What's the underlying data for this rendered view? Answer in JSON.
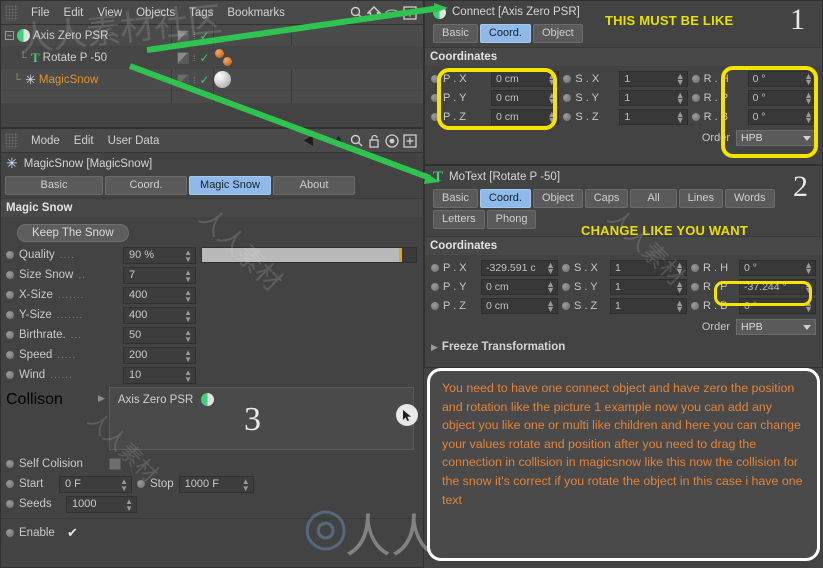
{
  "app": {
    "object_manager_menu": [
      "File",
      "Edit",
      "View",
      "Objects",
      "Tags",
      "Bookmarks"
    ],
    "attr_manager_menu": [
      "Mode",
      "Edit",
      "User Data"
    ]
  },
  "object_tree": {
    "rows": [
      {
        "name": "Axis Zero PSR",
        "icon": "connect-icon",
        "indent": 0,
        "color": "normal"
      },
      {
        "name": "Rotate P -50",
        "icon": "motext-icon",
        "indent": 1,
        "color": "normal"
      },
      {
        "name": "MagicSnow",
        "icon": "snow-icon",
        "indent": 0,
        "color": "orange"
      }
    ]
  },
  "attributes_magicsnow": {
    "title": "MagicSnow [MagicSnow]",
    "tabs": [
      {
        "label": "Basic",
        "active": false
      },
      {
        "label": "Coord.",
        "active": false
      },
      {
        "label": "Magic Snow",
        "active": true
      },
      {
        "label": "About",
        "active": false
      }
    ],
    "section": "Magic Snow",
    "keep_button": "Keep The Snow",
    "fields": [
      {
        "label": "Quality",
        "dots": "....",
        "value": "90 %",
        "slider": true,
        "slider_pct": 90
      },
      {
        "label": "Size Snow",
        "dots": "..",
        "value": "7"
      },
      {
        "label": "X-Size",
        "dots": ".......",
        "value": "400"
      },
      {
        "label": "Y-Size",
        "dots": ".......",
        "value": "400"
      },
      {
        "label": "Birthrate.",
        "dots": "...",
        "value": "50"
      },
      {
        "label": "Speed",
        "dots": ".....",
        "value": "200"
      },
      {
        "label": "Wind",
        "dots": "......",
        "value": "10"
      }
    ],
    "collision_label": "Collison",
    "collision_item": "Axis Zero PSR",
    "self_collision_label": "Self Colision",
    "start_label": "Start",
    "start_value": "0 F",
    "stop_label": "Stop",
    "stop_value": "1000 F",
    "seeds_label": "Seeds",
    "seeds_value": "1000",
    "enable_label": "Enable"
  },
  "attributes_connect": {
    "title": "Connect [Axis Zero PSR]",
    "tabs": [
      {
        "label": "Basic",
        "active": false
      },
      {
        "label": "Coord.",
        "active": true
      },
      {
        "label": "Object",
        "active": false
      }
    ],
    "section": "Coordinates",
    "rows": [
      {
        "p_label": "P . X",
        "p_value": "0 cm",
        "s_label": "S . X",
        "s_value": "1",
        "r_label": "R . H",
        "r_value": "0 °"
      },
      {
        "p_label": "P . Y",
        "p_value": "0 cm",
        "s_label": "S . Y",
        "s_value": "1",
        "r_label": "R . P",
        "r_value": "0 °"
      },
      {
        "p_label": "P . Z",
        "p_value": "0 cm",
        "s_label": "S . Z",
        "s_value": "1",
        "r_label": "R . B",
        "r_value": "0 °"
      }
    ],
    "order_label": "Order",
    "order_value": "HPB"
  },
  "attributes_motext": {
    "title": "MoText [Rotate P -50]",
    "tabs": [
      {
        "label": "Basic",
        "active": false
      },
      {
        "label": "Coord.",
        "active": true
      },
      {
        "label": "Object",
        "active": false
      },
      {
        "label": "Caps",
        "active": false
      },
      {
        "label": "All",
        "active": false
      },
      {
        "label": "Lines",
        "active": false
      },
      {
        "label": "Words",
        "active": false
      },
      {
        "label": "Letters",
        "active": false
      },
      {
        "label": "Phong",
        "active": false
      }
    ],
    "section": "Coordinates",
    "rows": [
      {
        "p_label": "P . X",
        "p_value": "-329.591 c",
        "s_label": "S . X",
        "s_value": "1",
        "r_label": "R . H",
        "r_value": "0 °"
      },
      {
        "p_label": "P . Y",
        "p_value": "0 cm",
        "s_label": "S . Y",
        "s_value": "1",
        "r_label": "R . P",
        "r_value": "-37.244 °"
      },
      {
        "p_label": "P . Z",
        "p_value": "0 cm",
        "s_label": "S . Z",
        "s_value": "1",
        "r_label": "R . B",
        "r_value": "0 °"
      }
    ],
    "order_label": "Order",
    "order_value": "HPB",
    "freeze_label": "Freeze Transformation"
  },
  "annotations": {
    "note1_text": "THIS MUST BE LIKE",
    "note1_num": "1",
    "note2_text": "CHANGE LIKE YOU WANT",
    "note2_num": "2",
    "note3_num": "3",
    "callout": "You need to have one connect object and have zero the position and rotation like the picture 1  example now you can add any object you like one or multi like children and here you can change your values rotate and position after you need to drag the connection in collision in magicsnow like this now the collision for the snow it's correct if you rotate the object in this case i have one text"
  },
  "colors": {
    "highlight": "#f5e400",
    "annotation_yellow": "#e8e000",
    "callout_text": "#e2833a",
    "arrow_green": "#2fc44f",
    "tab_active": "#8fb9e8",
    "orange_label": "#e0952c"
  },
  "watermark": {
    "text_cn": "人人素材",
    "logo": "M"
  }
}
